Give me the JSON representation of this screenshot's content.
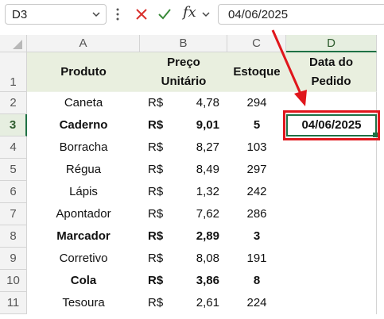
{
  "formula_bar": {
    "name_box": "D3",
    "fx_label": "fx",
    "formula_value": "04/06/2025"
  },
  "columns": [
    "A",
    "B",
    "C",
    "D"
  ],
  "rows": [
    "1",
    "2",
    "3",
    "4",
    "5",
    "6",
    "7",
    "8",
    "9",
    "10",
    "11"
  ],
  "headers": {
    "produto": "Produto",
    "preco_line1": "Preço",
    "preco_line2": "Unitário",
    "estoque": "Estoque",
    "data_line1": "Data do",
    "data_line2": "Pedido"
  },
  "data_rows": [
    {
      "produto": "Caneta",
      "currency": "R$",
      "preco": "4,78",
      "estoque": "294",
      "bold": false
    },
    {
      "produto": "Caderno",
      "currency": "R$",
      "preco": "9,01",
      "estoque": "5",
      "bold": true
    },
    {
      "produto": "Borracha",
      "currency": "R$",
      "preco": "8,27",
      "estoque": "103",
      "bold": false
    },
    {
      "produto": "Régua",
      "currency": "R$",
      "preco": "8,49",
      "estoque": "297",
      "bold": false
    },
    {
      "produto": "Lápis",
      "currency": "R$",
      "preco": "1,32",
      "estoque": "242",
      "bold": false
    },
    {
      "produto": "Apontador",
      "currency": "R$",
      "preco": "7,62",
      "estoque": "286",
      "bold": false
    },
    {
      "produto": "Marcador",
      "currency": "R$",
      "preco": "2,89",
      "estoque": "3",
      "bold": true
    },
    {
      "produto": "Corretivo",
      "currency": "R$",
      "preco": "8,08",
      "estoque": "191",
      "bold": false
    },
    {
      "produto": "Cola",
      "currency": "R$",
      "preco": "3,86",
      "estoque": "8",
      "bold": true
    },
    {
      "produto": "Tesoura",
      "currency": "R$",
      "preco": "2,61",
      "estoque": "224",
      "bold": false
    }
  ],
  "selected_cell": {
    "ref": "D3",
    "value": "04/06/2025"
  },
  "colors": {
    "header_fill": "#e9efdf",
    "selection_green": "#1e7145",
    "annotation_red": "#e0161c"
  }
}
